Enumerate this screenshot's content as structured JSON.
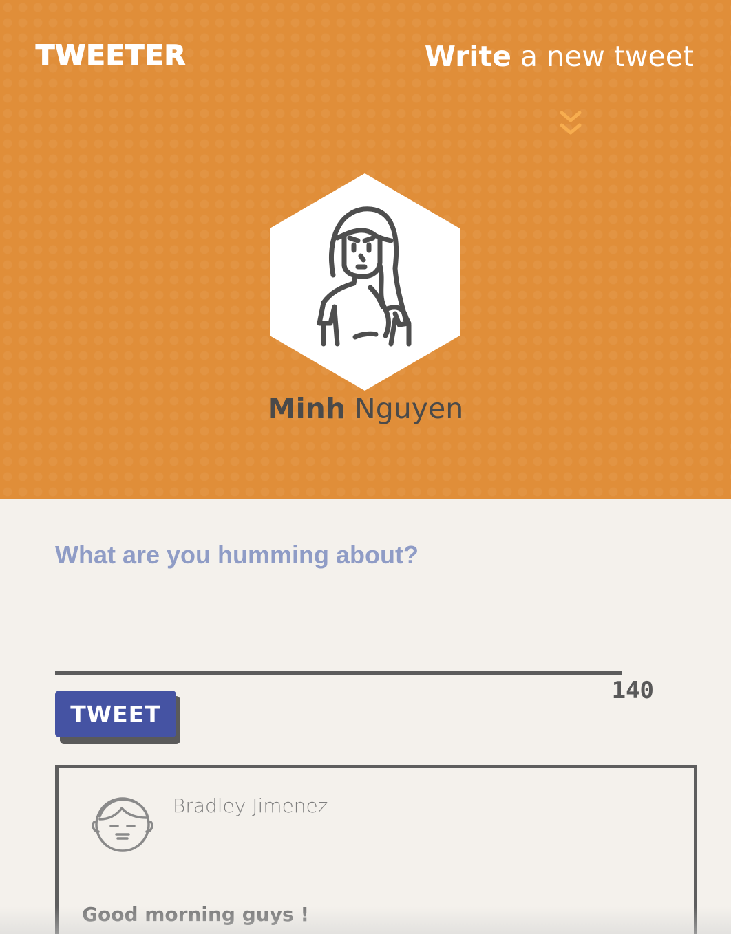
{
  "header": {
    "brand": "TWEETER",
    "compose_toggle": {
      "bold": "Write",
      "rest": " a new tweet"
    },
    "profile": {
      "first_name": "Minh",
      "last_name": " Nguyen"
    }
  },
  "compose": {
    "placeholder": "What are you humming about?",
    "value": "",
    "counter": "140",
    "submit_label": "TWEET"
  },
  "tweets": [
    {
      "author": "Bradley Jimenez",
      "content": "Good morning guys !"
    }
  ],
  "colors": {
    "header_bg": "#e08e39",
    "page_bg": "#f4f1ec",
    "button_bg": "#4553a3",
    "placeholder": "#8f9cc6",
    "chevron": "#f7ad4f"
  },
  "icons": {
    "chevron": "double-chevron-down-icon",
    "profile_avatar": "woman-avatar-icon",
    "tweet_avatar": "man-face-avatar-icon"
  }
}
